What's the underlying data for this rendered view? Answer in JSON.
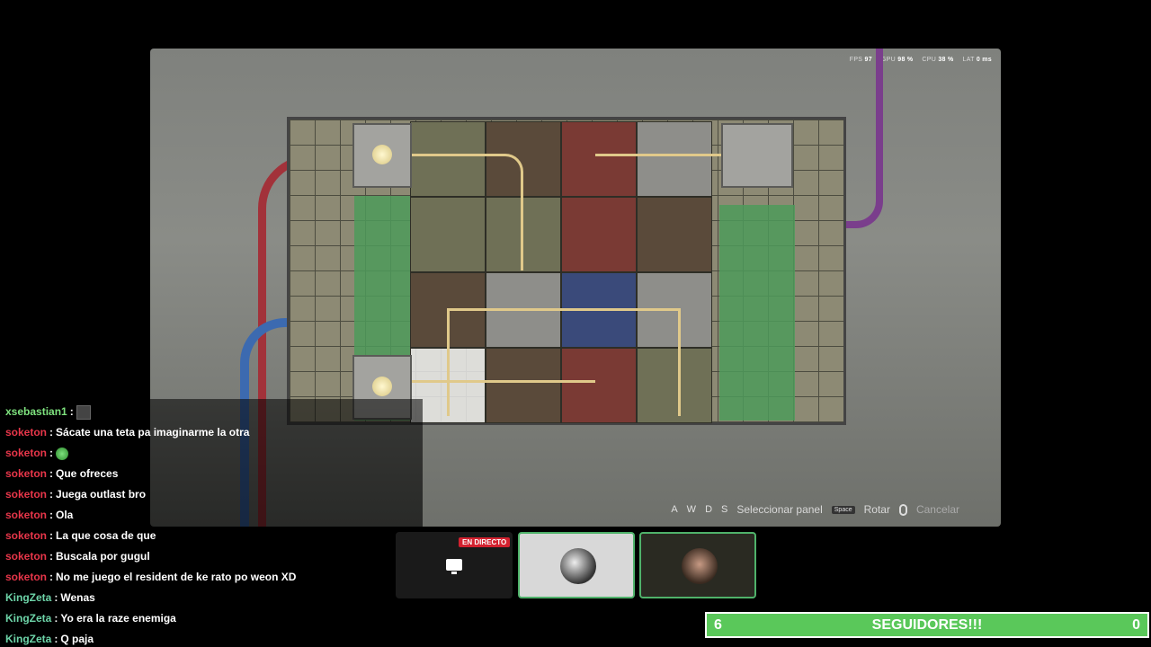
{
  "game": {
    "stats": [
      {
        "label": "FPS",
        "value": "97"
      },
      {
        "label": "GPU",
        "value": "98 %"
      },
      {
        "label": "CPU",
        "value": "38 %"
      },
      {
        "label": "LAT",
        "value": "0 ms"
      }
    ],
    "controls": {
      "keys": [
        "A",
        "W",
        "D",
        "S"
      ],
      "select_label": "Seleccionar panel",
      "space_key": "Space",
      "rotate_label": "Rotar",
      "cancel_label": "Cancelar"
    }
  },
  "chat": [
    {
      "user": "xsebastian1",
      "color": "#7ee27e",
      "text": "",
      "emote": "image"
    },
    {
      "user": "soketon",
      "color": "#e8364a",
      "text": "Sácate una teta pa imaginarme la otra"
    },
    {
      "user": "soketon",
      "color": "#e8364a",
      "text": "",
      "emote": "green"
    },
    {
      "user": "soketon",
      "color": "#e8364a",
      "text": "Que ofreces"
    },
    {
      "user": "soketon",
      "color": "#e8364a",
      "text": "Juega outlast bro"
    },
    {
      "user": "soketon",
      "color": "#e8364a",
      "text": "Ola"
    },
    {
      "user": "soketon",
      "color": "#e8364a",
      "text": "La que cosa de que"
    },
    {
      "user": "soketon",
      "color": "#e8364a",
      "text": "Buscala por gugul"
    },
    {
      "user": "soketon",
      "color": "#e8364a",
      "text": "No me juego el resident de ke rato po weon XD"
    },
    {
      "user": "KingZeta",
      "color": "#6dd4a8",
      "text": "Wenas"
    },
    {
      "user": "KingZeta",
      "color": "#6dd4a8",
      "text": "Yo era la raze enemiga"
    },
    {
      "user": "KingZeta",
      "color": "#6dd4a8",
      "text": "Q paja"
    }
  ],
  "cams": {
    "live_label": "EN DIRECTO"
  },
  "followers": {
    "current": "6",
    "label": "SEGUIDORES!!!",
    "goal": "0"
  }
}
